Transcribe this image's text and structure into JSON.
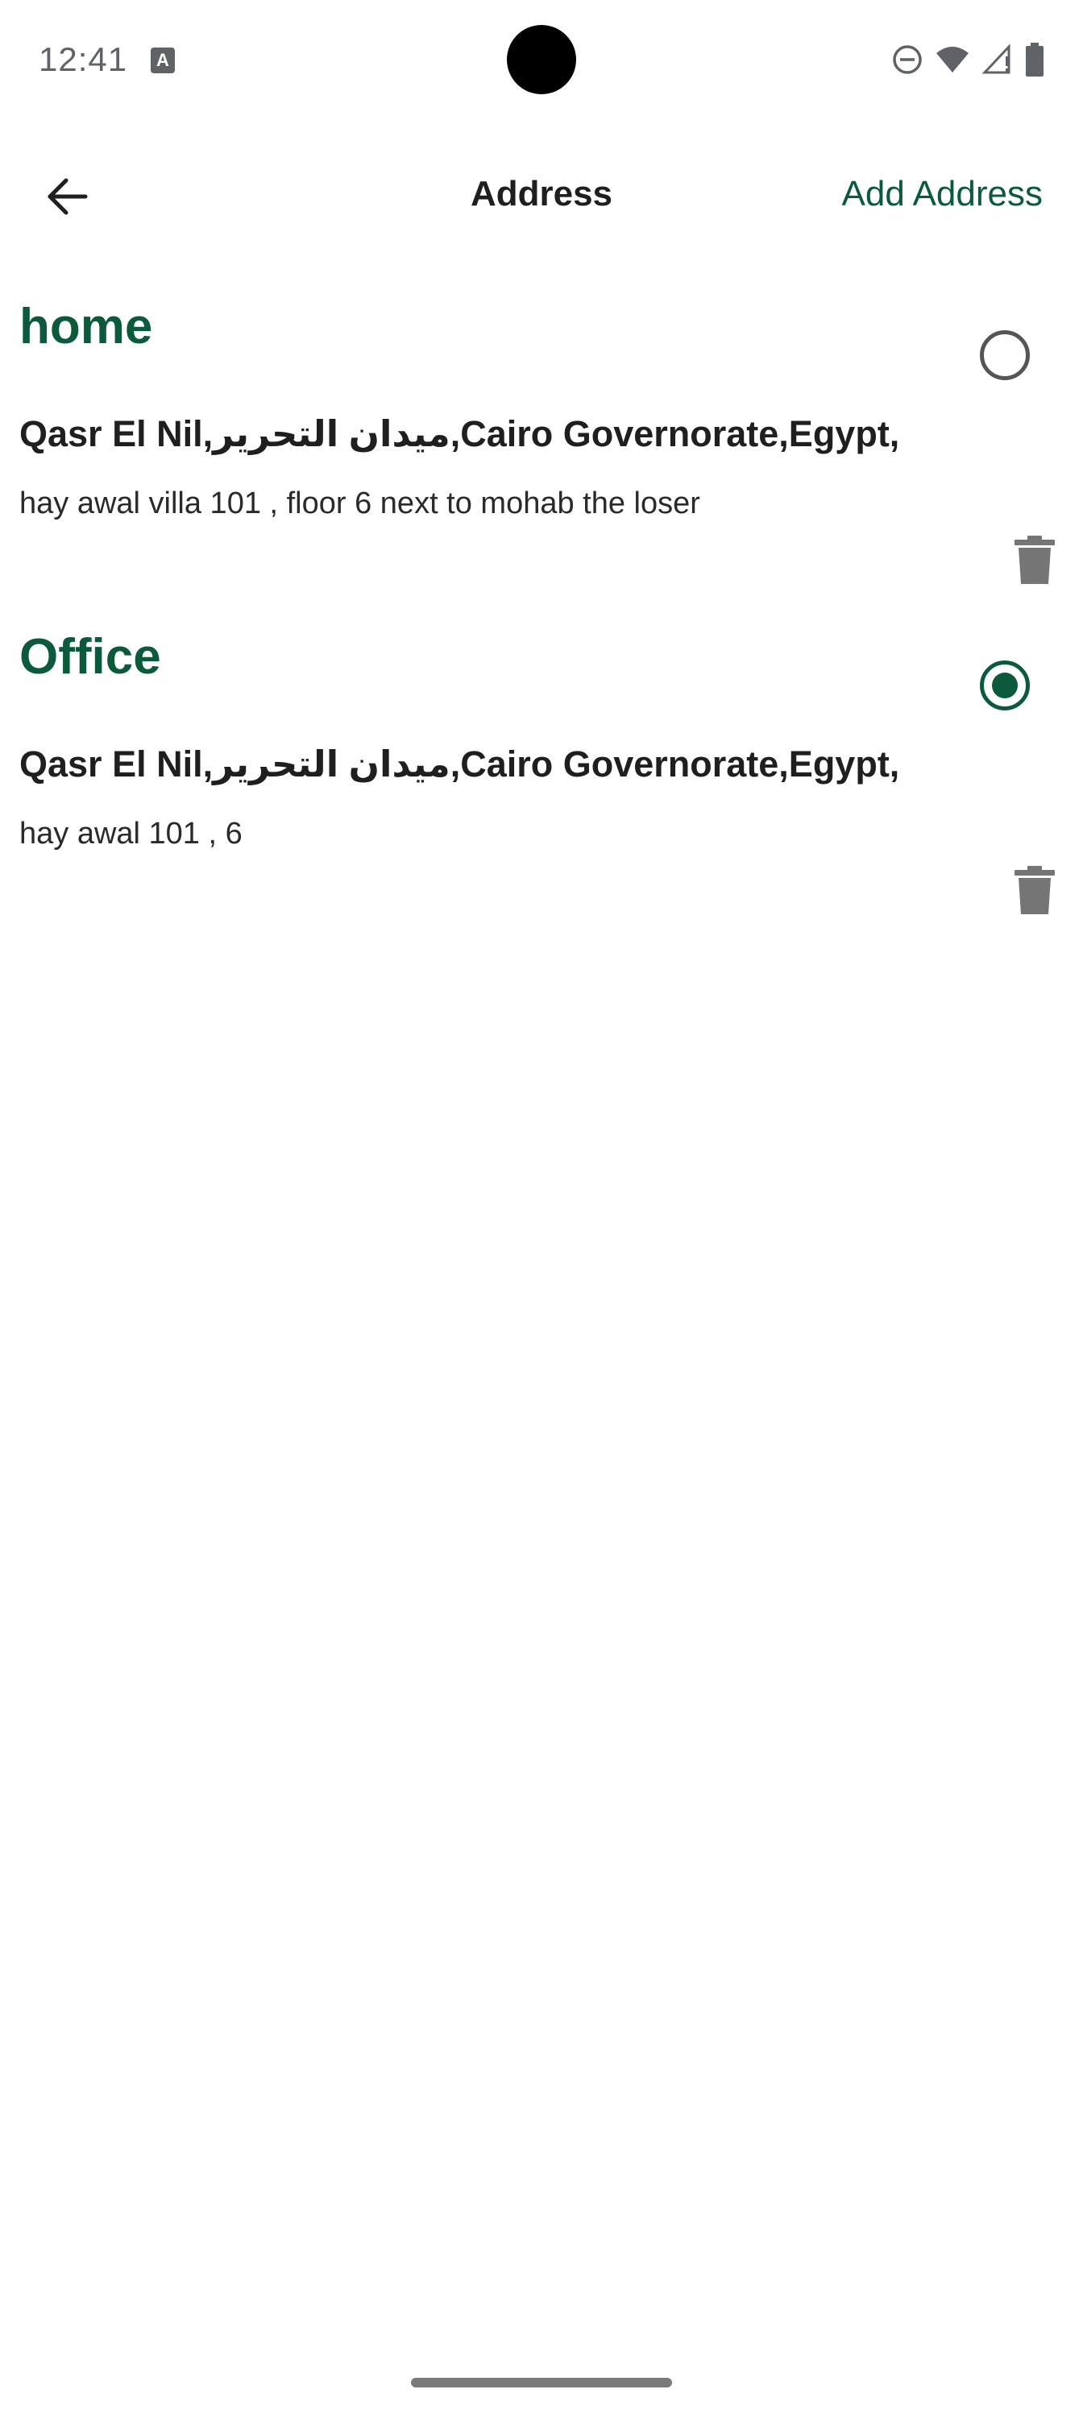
{
  "status_bar": {
    "time": "12:41",
    "notification_icon": "A",
    "icons": [
      "do-not-disturb-icon",
      "wifi-icon",
      "cellular-signal-icon",
      "battery-icon"
    ]
  },
  "app_bar": {
    "title": "Address",
    "add_address_label": "Add Address",
    "back_icon": "arrow-back-icon"
  },
  "addresses": [
    {
      "name": "home",
      "line": "Qasr El Nil,ميدان التحرير,Cairo Governorate,Egypt,",
      "details": "hay awal villa 101 , floor 6 next to mohab the loser",
      "selected": false
    },
    {
      "name": "Office",
      "line": "Qasr El Nil,ميدان التحرير,Cairo Governorate,Egypt,",
      "details": "hay awal 101 , 6",
      "selected": true
    }
  ],
  "colors": {
    "accent": "#0b5a3c",
    "text": "#1f1f1f",
    "icon_gray": "#757575"
  }
}
